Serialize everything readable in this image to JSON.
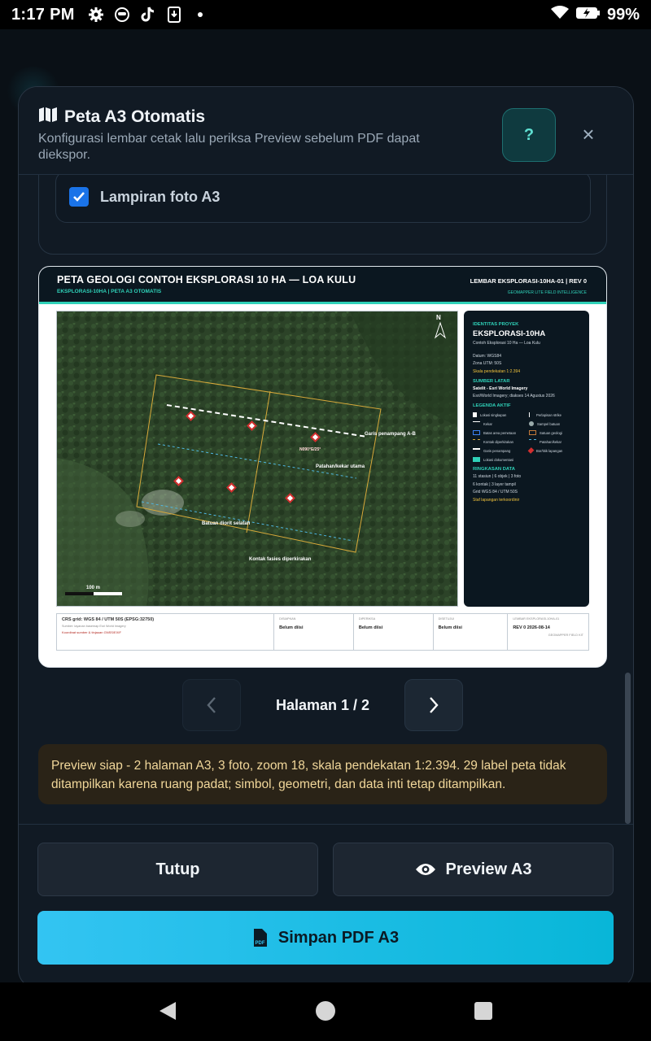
{
  "status": {
    "time": "1:17 PM",
    "battery": "99%"
  },
  "dialog": {
    "title": "Peta A3 Otomatis",
    "subtitle": "Konfigurasi lembar cetak lalu periksa Preview sebelum PDF dapat diekspor.",
    "help_label": "?",
    "close_label": "×"
  },
  "options": {
    "photo_attach_label": "Lampiran foto A3",
    "photo_attach_checked": true
  },
  "sheet": {
    "title": "PETA GEOLOGI CONTOH EKSPLORASI 10 HA — LOA KULU",
    "subtitle": "EKSPLORASI-10HA | PETA A3 OTOMATIS",
    "sheet_id": "LEMBAR EKSPLORASI-10HA-01 | REV 0",
    "brand": "GEOMAPPER LITE FIELD INTELLIGENCE",
    "north": "N",
    "scale_bar": "100 m",
    "map_labels": {
      "section_line": "Garis penampang A-B",
      "fault": "Patahan/kekar utama",
      "contact": "Kontak fasies diperkirakan",
      "strike_label": "N090°E/25°",
      "unit": "Batuan diorit selatan"
    },
    "info": {
      "project_head": "IDENTITAS PROYEK",
      "project_name": "EKSPLORASI-10HA",
      "project_desc": "Contoh Eksplorasi 10 Ha — Loa Kulu",
      "datum": "Datum: WGS84",
      "zone": "Zona UTM: 50S",
      "scale": "Skala pendekatan 1:2.394",
      "bg_head": "SUMBER LATAR",
      "bg_value": "Satelit - Esri World Imagery",
      "bg_note": "Esri/World Imagery; diakses 14 Agustus 2026",
      "legend_head": "LEGENDA AKTIF",
      "legend": [
        "Lokasi singkapan",
        "Perlapisan strike",
        "Kekar",
        "Sampel batuan",
        "Batas area pemetaan",
        "Satuan geologi",
        "Kontak diperkirakan",
        "Patahan/kekar",
        "Garis penampang",
        "Bor/titik lapangan",
        "Lokasi dokumentasi"
      ],
      "summary_head": "RINGKASAN DATA",
      "summary_1": "11 stasiun | 6 objek | 3 foto",
      "summary_2": "6 kontak | 3 layer tampil",
      "summary_3": "Grid WGS 84 / UTM 50S",
      "summary_note": "Staf lapangan terkoordinir"
    },
    "footer": {
      "crs": "CRS grid: WGS 84 / UTM 50S (EPSG:32750)",
      "crs_note": "Sumber: layanan basemap Esri World Imagery",
      "crs_warn": "Koordinat sumber & tinjauan GNSS/EXIF",
      "f1_cap": "DISIAPKAN",
      "f1_val": "Belum diisi",
      "f2_cap": "DIPERIKSA",
      "f2_val": "Belum diisi",
      "f3_cap": "DISETUJUI",
      "f3_val": "Belum diisi",
      "f4_cap": "LEMBAR EKSPLORASI-10HA-01",
      "f4_val": "REV 0   2026-08-14",
      "f4_brand": "GEOMAPPER FIELD KIT"
    }
  },
  "pager": {
    "label": "Halaman 1 / 2"
  },
  "notice": "Preview siap - 2 halaman A3, 3 foto, zoom 18, skala pendekatan 1:2.394. 29 label peta tidak ditampilkan karena ruang padat; simbol, geometri, dan data inti tetap ditampilkan.",
  "buttons": {
    "close": "Tutup",
    "preview": "Preview A3",
    "save": "Simpan PDF A3"
  }
}
